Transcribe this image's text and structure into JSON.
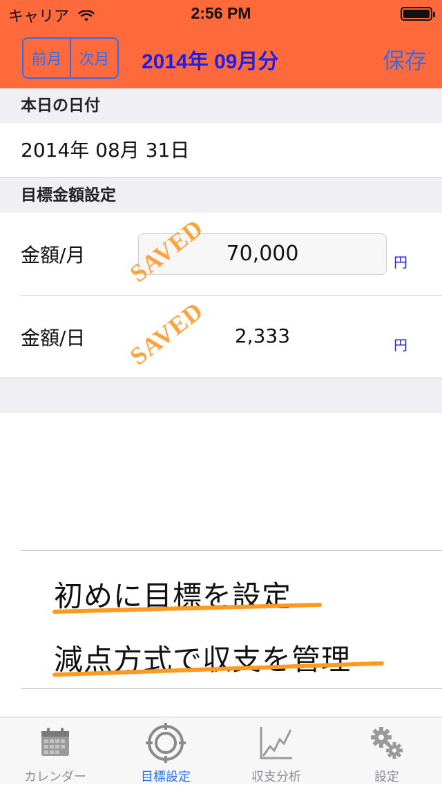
{
  "status_bar": {
    "carrier": "キャリア",
    "time": "2:56 PM"
  },
  "nav": {
    "prev_label": "前月",
    "next_label": "次月",
    "month_title": "2014年 09月分",
    "save_label": "保存"
  },
  "today": {
    "header": "本日の日付",
    "date": "2014年 08月 31日"
  },
  "target": {
    "header": "目標金額設定",
    "monthly_label": "金額/月",
    "monthly_value": "70,000",
    "daily_label": "金額/日",
    "daily_value": "2,333",
    "unit": "円",
    "stamp": "SAVED"
  },
  "promo": {
    "line1": "初めに目標を設定",
    "line2": "減点方式で収支を管理"
  },
  "tabs": [
    {
      "label": "カレンダー",
      "icon": "calendar-icon"
    },
    {
      "label": "目標設定",
      "icon": "target-icon"
    },
    {
      "label": "収支分析",
      "icon": "chart-icon"
    },
    {
      "label": "設定",
      "icon": "gear-icon"
    }
  ],
  "colors": {
    "nav_bg": "#ff6a3d",
    "accent": "#2d6df0",
    "title": "#1f1fe6",
    "stamp": "#ff9a2e"
  }
}
